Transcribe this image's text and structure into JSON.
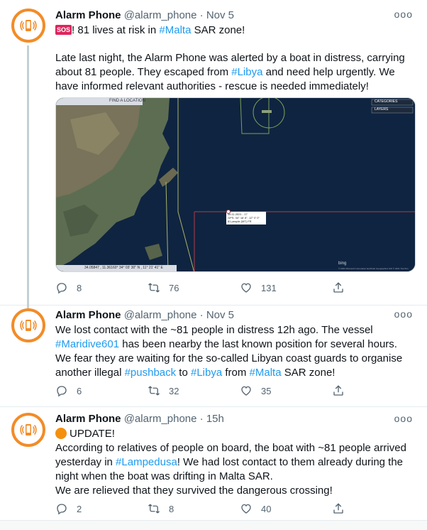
{
  "tweets": [
    {
      "name": "Alarm Phone",
      "handle": "@alarm_phone",
      "dot": "·",
      "time": "Nov 5",
      "more": "ooo",
      "sos_badge": "SOS",
      "line1_a": "! 81 lives at risk in ",
      "line1_tag": "#Malta",
      "line1_b": " SAR zone!",
      "p2_a": "Late last night, the Alarm Phone was alerted by a boat in distress, carrying about 81 people. They escaped from ",
      "p2_tag": "#Libya",
      "p2_b": " and need help urgently. We have informed relevant authorities - rescue is needed immediately!",
      "replies": "8",
      "retweets": "76",
      "likes": "131",
      "map": {
        "toolbar_text": "FIND A LOCATION",
        "categories_label": "CATEGORIES",
        "layers_label": "LAYERS",
        "popup_line1": "06.11.2021 - 17",
        "popup_line2": "GPS: 34° 16' 8\", 12° 0' 0\"",
        "popup_line3": "81 people (MT) FR",
        "coords_text": "34.05847 , 11.36160°    34° 03' 30\" N , 11° 21' 41\" E",
        "bing_text": "bing",
        "copyright_text": "© 2021 Microsoft Corporation Earthstar Geographics SIO © 2021 TomTom"
      }
    },
    {
      "name": "Alarm Phone",
      "handle": "@alarm_phone",
      "dot": "·",
      "time": "Nov 5",
      "more": "ooo",
      "t_a": "We lost contact with the ~81 people in distress 12h ago. The vessel ",
      "t_tag1": "#Maridive601",
      "t_b": " has been nearby the last known position for several hours. We fear they are waiting for the so-called Libyan coast guards to organise another illegal ",
      "t_tag2": "#pushback",
      "t_c": " to ",
      "t_tag3": "#Libya",
      "t_d": " from ",
      "t_tag4": "#Malta",
      "t_e": " SAR zone!",
      "replies": "6",
      "retweets": "32",
      "likes": "35"
    },
    {
      "name": "Alarm Phone",
      "handle": "@alarm_phone",
      "dot": "·",
      "time": "15h",
      "more": "ooo",
      "update": "UPDATE!",
      "t_a": "According to relatives of people on board, the boat with ~81 people arrived yesterday in ",
      "t_tag1": "#Lampedusa",
      "t_b": "! We had lost contact to them already during the night when the boat was drifting in Malta SAR.",
      "t_c": "We are relieved that they survived the dangerous crossing!",
      "replies": "2",
      "retweets": "8",
      "likes": "40"
    }
  ],
  "colors": {
    "avatar_ring": "#f28c28",
    "link": "#1d9bf0",
    "secondary_text": "#536471",
    "sos": "#e0245e"
  }
}
